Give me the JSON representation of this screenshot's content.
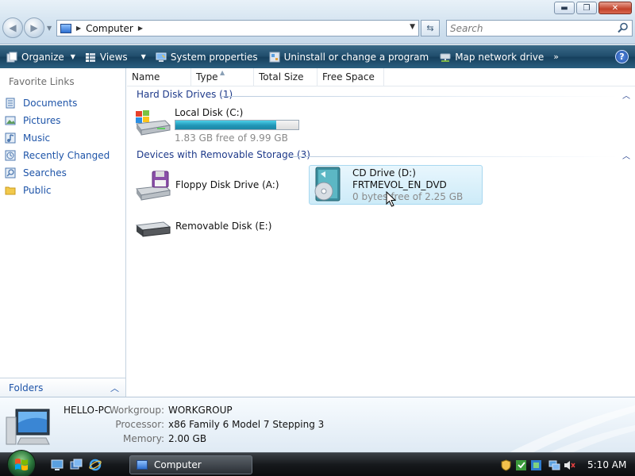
{
  "window": {
    "min_label": "▬",
    "max_label": "❐",
    "close_label": "✕"
  },
  "address": {
    "crumb": "Computer",
    "sep": "▶"
  },
  "search": {
    "placeholder": "Search"
  },
  "commandbar": {
    "organize": "Organize",
    "views": "Views",
    "system_properties": "System properties",
    "uninstall": "Uninstall or change a program",
    "map_drive": "Map network drive",
    "more": "»",
    "help": "?"
  },
  "leftpane": {
    "favorite_links_title": "Favorite Links",
    "items": [
      {
        "label": "Documents",
        "icon": "documents-icon"
      },
      {
        "label": "Pictures",
        "icon": "pictures-icon"
      },
      {
        "label": "Music",
        "icon": "music-icon"
      },
      {
        "label": "Recently Changed",
        "icon": "recently-changed-icon"
      },
      {
        "label": "Searches",
        "icon": "searches-icon"
      },
      {
        "label": "Public",
        "icon": "public-folder-icon"
      }
    ],
    "folders_label": "Folders"
  },
  "columns": {
    "name": "Name",
    "type": "Type",
    "total_size": "Total Size",
    "free_space": "Free Space"
  },
  "groups": {
    "hard_disk": "Hard Disk Drives (1)",
    "removable": "Devices with Removable Storage (3)"
  },
  "drives": {
    "c": {
      "name": "Local Disk (C:)",
      "free_text": "1.83 GB free of 9.99 GB",
      "used_fraction": 0.817
    },
    "a": {
      "name": "Floppy Disk Drive (A:)"
    },
    "d": {
      "name": "CD Drive (D:)",
      "label": "FRTMEVOL_EN_DVD",
      "free_text": "0 bytes free of 2.25 GB"
    },
    "e": {
      "name": "Removable Disk (E:)"
    }
  },
  "details": {
    "computer_name": "HELLO-PC",
    "workgroup_label": "Workgroup:",
    "workgroup_value": "WORKGROUP",
    "processor_label": "Processor:",
    "processor_value": "x86 Family 6 Model 7 Stepping 3",
    "memory_label": "Memory:",
    "memory_value": "2.00 GB"
  },
  "taskbar": {
    "task_label": "Computer",
    "clock": "5:10 AM"
  },
  "colors": {
    "link_blue": "#1e54a8",
    "group_blue": "#1e3a8a",
    "command_bar": "#1f4c6b",
    "progress_fill": "#2196b7"
  }
}
